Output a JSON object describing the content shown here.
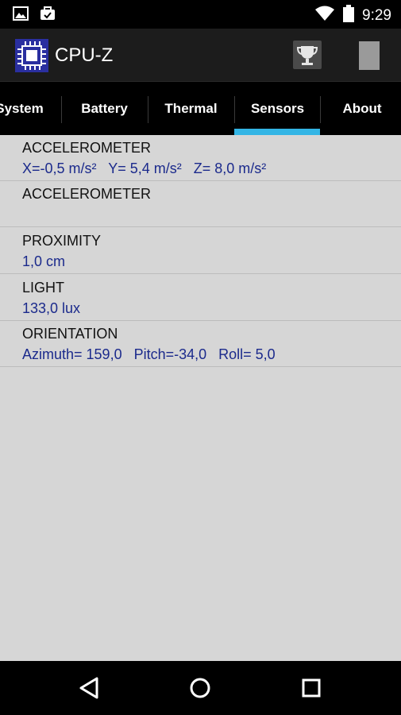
{
  "status_bar": {
    "time": "9:29",
    "icons": [
      "gallery-icon",
      "briefcase-icon",
      "wifi-icon",
      "battery-icon"
    ]
  },
  "app": {
    "title": "CPU-Z",
    "icons": [
      "cpu-chip-icon",
      "trophy-icon",
      "overflow-menu-icon"
    ]
  },
  "tabs": [
    {
      "label": "System",
      "active": false
    },
    {
      "label": "Battery",
      "active": false
    },
    {
      "label": "Thermal",
      "active": false
    },
    {
      "label": "Sensors",
      "active": true
    },
    {
      "label": "About",
      "active": false
    }
  ],
  "sensors": [
    {
      "name": "ACCELEROMETER",
      "value": "X=-0,5 m/s²   Y= 5,4 m/s²   Z= 8,0 m/s²"
    },
    {
      "name": "ACCELEROMETER",
      "value": ""
    },
    {
      "name": "PROXIMITY",
      "value": "1,0 cm"
    },
    {
      "name": "LIGHT",
      "value": "133,0 lux"
    },
    {
      "name": "ORIENTATION",
      "value": "Azimuth= 159,0   Pitch=-34,0   Roll= 5,0"
    }
  ],
  "nav_bar": {
    "icons": [
      "back-icon",
      "home-icon",
      "recents-icon"
    ]
  },
  "colors": {
    "accent": "#33b5e5",
    "value_text": "#1b2a8c",
    "content_bg": "#d6d6d6"
  }
}
